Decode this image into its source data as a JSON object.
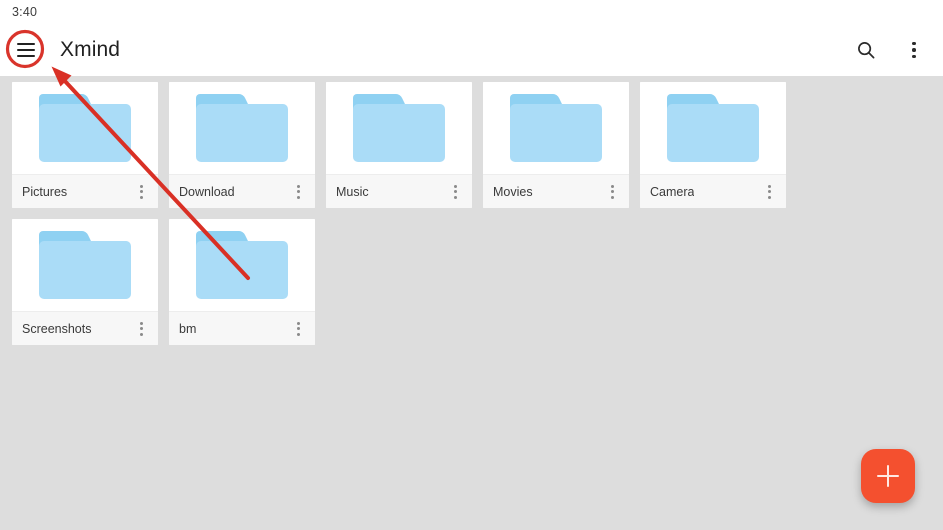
{
  "status_bar": {
    "time": "3:40"
  },
  "toolbar": {
    "menu_icon": "hamburger-menu-icon",
    "title": "Xmind",
    "search_icon": "search-icon",
    "overflow_icon": "more-vertical-icon"
  },
  "main": {
    "folders": [
      {
        "name": "Pictures",
        "icon": "folder-icon",
        "menu_icon": "more-vertical-icon"
      },
      {
        "name": "Download",
        "icon": "folder-icon",
        "menu_icon": "more-vertical-icon"
      },
      {
        "name": "Music",
        "icon": "folder-icon",
        "menu_icon": "more-vertical-icon"
      },
      {
        "name": "Movies",
        "icon": "folder-icon",
        "menu_icon": "more-vertical-icon"
      },
      {
        "name": "Camera",
        "icon": "folder-icon",
        "menu_icon": "more-vertical-icon"
      },
      {
        "name": "Screenshots",
        "icon": "folder-icon",
        "menu_icon": "more-vertical-icon"
      },
      {
        "name": "bm",
        "icon": "folder-icon",
        "menu_icon": "more-vertical-icon"
      }
    ]
  },
  "fab": {
    "icon": "plus-icon",
    "color": "#f4502f"
  },
  "annotation": {
    "highlight_color": "#d9342b",
    "arrow_color": "#d93025",
    "target": "hamburger-menu-icon"
  },
  "colors": {
    "page_background": "#dddddd",
    "card_background": "#ffffff",
    "card_label_background": "#f7f7f7",
    "folder_body": "#aadcf7",
    "folder_tab": "#8fd1f2",
    "toolbar_background": "#ffffff",
    "accent": "#f4502f"
  }
}
